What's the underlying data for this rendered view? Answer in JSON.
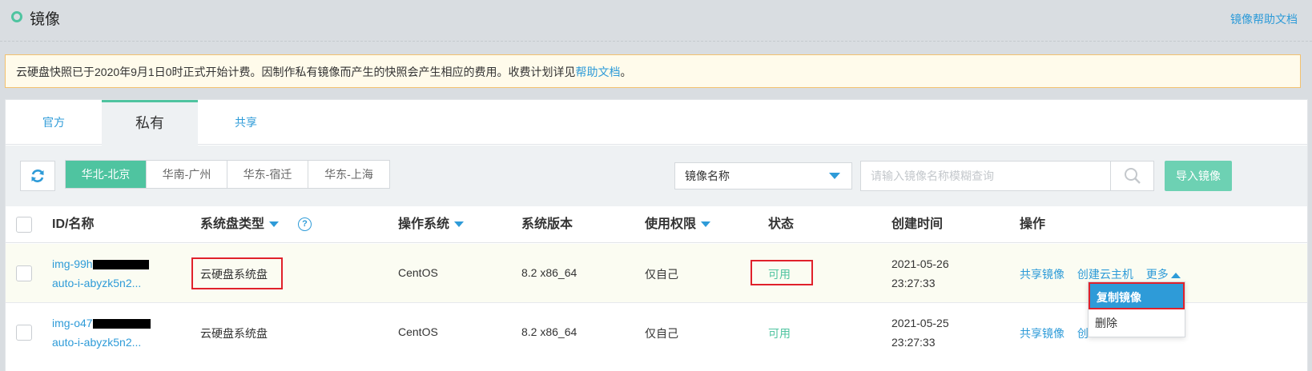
{
  "page": {
    "title": "镜像",
    "help_link": "镜像帮助文档"
  },
  "notice": {
    "text": "云硬盘快照已于2020年9月1日0时正式开始计费。因制作私有镜像而产生的快照会产生相应的费用。收费计划详见",
    "link": "帮助文档",
    "suffix": "。"
  },
  "tabs": [
    {
      "label": "官方",
      "active": false
    },
    {
      "label": "私有",
      "active": true
    },
    {
      "label": "共享",
      "active": false
    }
  ],
  "regions": [
    {
      "label": "华北-北京",
      "active": true
    },
    {
      "label": "华南-广州",
      "active": false
    },
    {
      "label": "华东-宿迁",
      "active": false
    },
    {
      "label": "华东-上海",
      "active": false
    }
  ],
  "filter": {
    "select_value": "镜像名称",
    "search_placeholder": "请输入镜像名称模糊查询",
    "import_button": "导入镜像"
  },
  "table": {
    "headers": {
      "id_name": "ID/名称",
      "disk_type": "系统盘类型",
      "os": "操作系统",
      "version": "系统版本",
      "permission": "使用权限",
      "status": "状态",
      "created": "创建时间",
      "actions": "操作"
    },
    "rows": [
      {
        "id": "img-99h",
        "name": "auto-i-abyzk5n2...",
        "disk_type": "云硬盘系统盘",
        "os": "CentOS",
        "version": "8.2 x86_64",
        "permission": "仅自己",
        "status": "可用",
        "created_date": "2021-05-26",
        "created_time": "23:27:33",
        "actions": {
          "share": "共享镜像",
          "create": "创建云主机",
          "more": "更多"
        }
      },
      {
        "id": "img-o47",
        "name": "auto-i-abyzk5n2...",
        "disk_type": "云硬盘系统盘",
        "os": "CentOS",
        "version": "8.2 x86_64",
        "permission": "仅自己",
        "status": "可用",
        "created_date": "2021-05-25",
        "created_time": "23:27:33",
        "actions": {
          "share": "共享镜像",
          "create": "创"
        }
      }
    ]
  },
  "dropdown": {
    "items": [
      "复制镜像",
      "删除"
    ]
  },
  "colors": {
    "accent": "#4fc4a0",
    "link": "#2e9bd8",
    "highlight": "#e0212b"
  }
}
